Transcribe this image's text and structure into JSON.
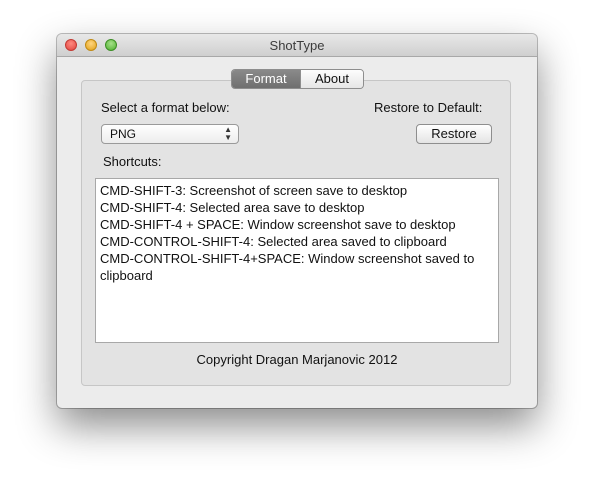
{
  "window": {
    "title": "ShotType"
  },
  "tabs": [
    {
      "label": "Format",
      "selected": true
    },
    {
      "label": "About",
      "selected": false
    }
  ],
  "format": {
    "label": "Select a format below:",
    "selected_value": "PNG"
  },
  "restore": {
    "label": "Restore to Default:",
    "button_label": "Restore"
  },
  "shortcuts": {
    "label": "Shortcuts:",
    "lines": [
      "CMD-SHIFT-3: Screenshot of screen save to desktop",
      "CMD-SHIFT-4: Selected area save to desktop",
      "CMD-SHIFT-4 + SPACE: Window screenshot save to desktop",
      "CMD-CONTROL-SHIFT-4: Selected area saved to clipboard",
      "CMD-CONTROL-SHIFT-4+SPACE: Window screenshot saved to",
      "clipboard"
    ]
  },
  "footer": {
    "copyright": "Copyright Dragan Marjanovic 2012"
  }
}
